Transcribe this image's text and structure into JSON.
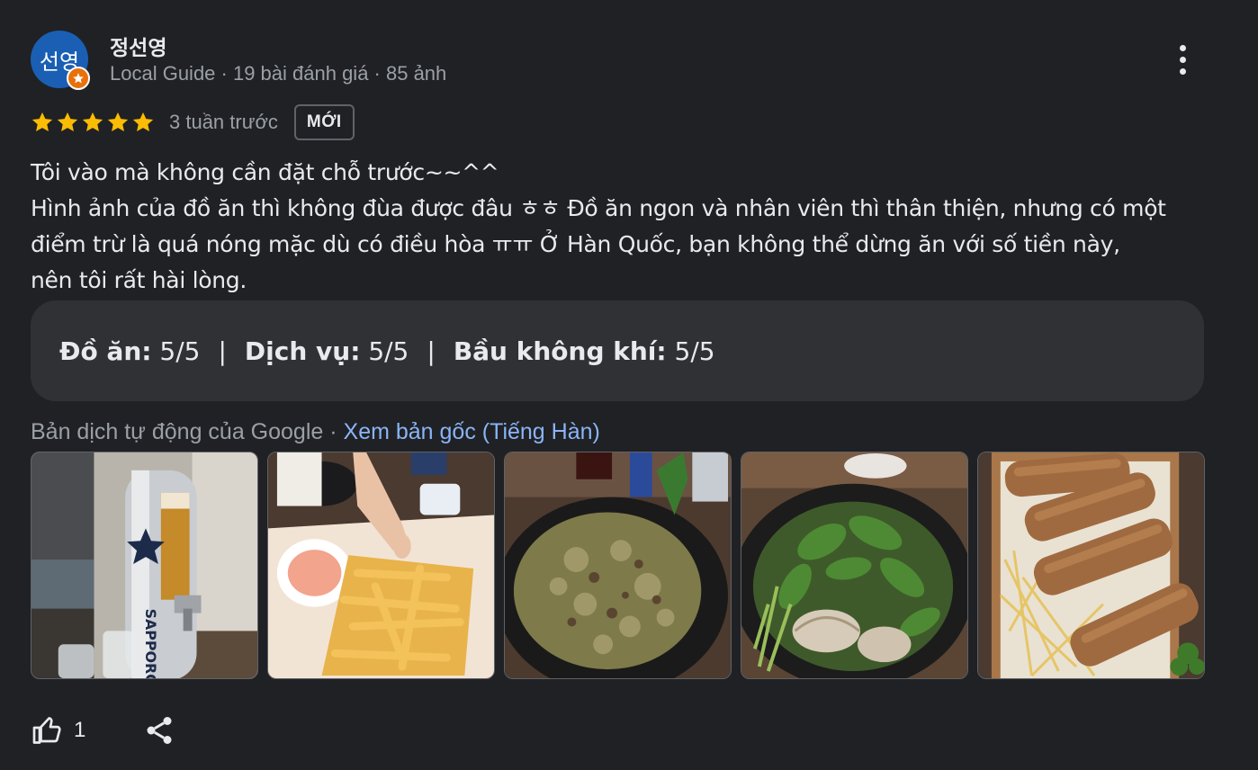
{
  "reviewer": {
    "avatar_text": "선영",
    "name": "정선영",
    "meta": "Local Guide · 19 bài đánh giá · 85 ảnh"
  },
  "rating": {
    "stars": 5,
    "time": "3 tuần trước",
    "badge": "MỚI"
  },
  "review_lines": [
    "Tôi vào mà không cần đặt chỗ trước~~^^",
    "Hình ảnh của đồ ăn thì không đùa được đâu ㅎㅎ Đồ ăn ngon và nhân viên thì thân thiện, nhưng có một",
    "điểm trừ là quá nóng mặc dù có điều hòa ㅠㅠ Ở Hàn Quốc, bạn không thể dừng ăn với số tiền này,",
    "nên tôi rất hài lòng."
  ],
  "sub_ratings": [
    {
      "label": "Đồ ăn:",
      "value": "5/5"
    },
    {
      "label": "Dịch vụ:",
      "value": "5/5"
    },
    {
      "label": "Bầu không khí:",
      "value": "5/5"
    }
  ],
  "sub_ratings_sep": "|",
  "translation": {
    "note": "Bản dịch tự động của Google · ",
    "link": "Xem bản gốc (Tiếng Hàn)"
  },
  "photos": [
    "sapporo-beer-tower-photo",
    "french-fries-photo",
    "stir-fried-noodles-photo",
    "clams-herbs-photo",
    "spring-rolls-photo"
  ],
  "actions": {
    "like_count": "1"
  },
  "colors": {
    "background": "#202124",
    "star": "#fbbc04",
    "link": "#8ab4f8",
    "avatar_bg": "#1a5fb4",
    "local_guide_badge": "#e8710a"
  }
}
